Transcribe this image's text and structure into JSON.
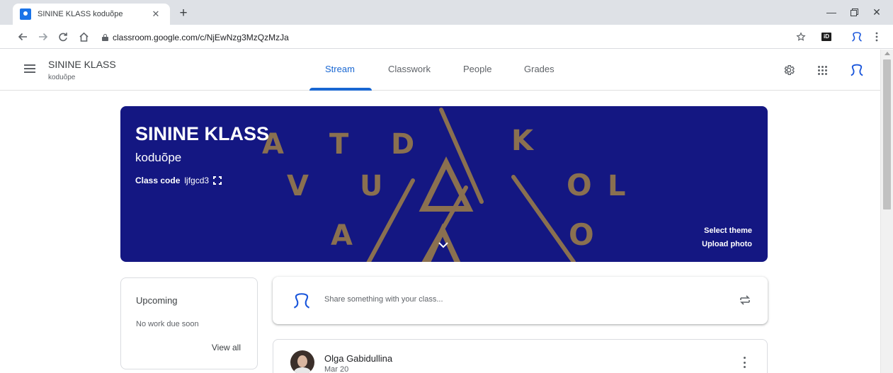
{
  "browser": {
    "tab_title": "SININE KLASS koduõpe",
    "url": "classroom.google.com/c/NjEwNzg3MzQzMzJa"
  },
  "header": {
    "class_name": "SININE KLASS",
    "class_section": "koduõpe",
    "tabs": [
      {
        "label": "Stream",
        "active": true
      },
      {
        "label": "Classwork",
        "active": false
      },
      {
        "label": "People",
        "active": false
      },
      {
        "label": "Grades",
        "active": false
      }
    ]
  },
  "banner": {
    "title": "SININE KLASS",
    "section": "koduõpe",
    "class_code_label": "Class code",
    "class_code": "ljfgcd3",
    "select_theme": "Select theme",
    "upload_photo": "Upload photo",
    "background_color": "#141782",
    "art_color": "#8a7050",
    "art_letters": [
      "A",
      "T",
      "D",
      "K",
      "V",
      "U",
      "A",
      "O",
      "L",
      "A",
      "A",
      "O"
    ]
  },
  "upcoming": {
    "title": "Upcoming",
    "empty_text": "No work due soon",
    "view_all": "View all"
  },
  "share": {
    "placeholder": "Share something with your class..."
  },
  "post": {
    "author": "Olga Gabidullina",
    "date": "Mar 20"
  },
  "colors": {
    "accent": "#1967d2",
    "text": "#3c4043",
    "muted": "#5f6368"
  }
}
